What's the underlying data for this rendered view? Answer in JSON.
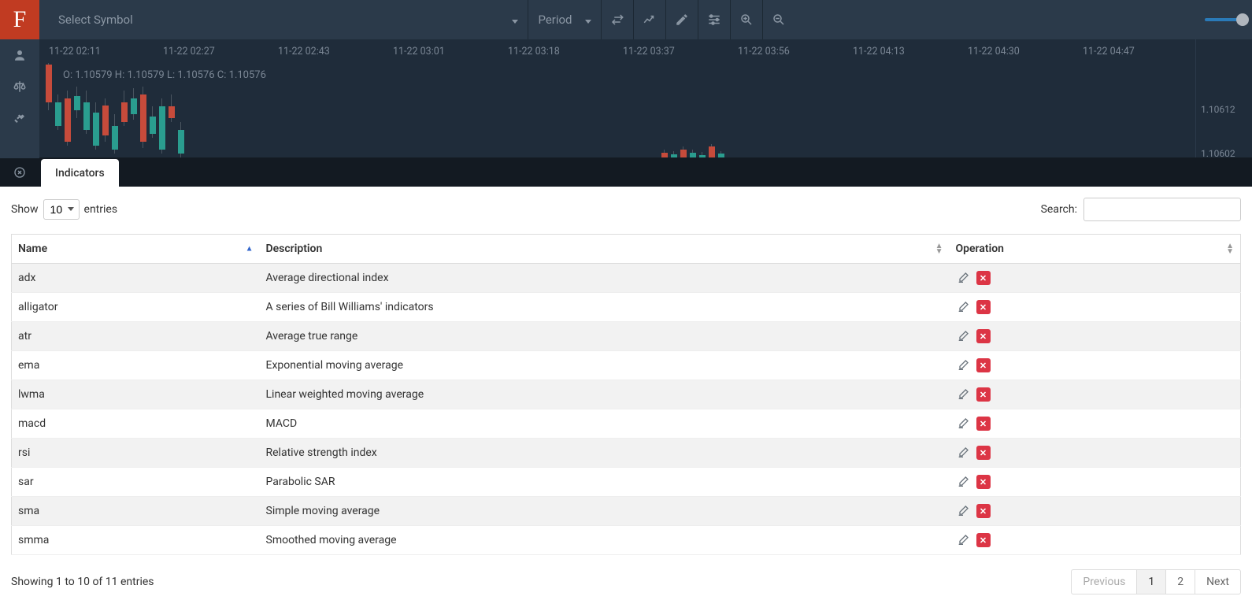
{
  "logo_letter": "F",
  "toolbar": {
    "symbol_placeholder": "Select Symbol",
    "period_label": "Period"
  },
  "chart": {
    "time_ticks": [
      "11-22 02:11",
      "11-22 02:27",
      "11-22 02:43",
      "11-22 03:01",
      "11-22 03:18",
      "11-22 03:37",
      "11-22 03:56",
      "11-22 04:13",
      "11-22 04:30",
      "11-22 04:47"
    ],
    "ohlc_text": "O: 1.10579 H: 1.10579 L: 1.10576 C: 1.10576",
    "price_ticks": [
      "1.10612",
      "1.10602"
    ]
  },
  "tab_label": "Indicators",
  "dt": {
    "show_prefix": "Show",
    "show_suffix": "entries",
    "length_options": [
      "10"
    ],
    "length_value": "10",
    "search_label": "Search:",
    "search_value": "",
    "columns": [
      "Name",
      "Description",
      "Operation"
    ],
    "rows": [
      {
        "name": "adx",
        "desc": "Average directional index"
      },
      {
        "name": "alligator",
        "desc": "A series of Bill Williams' indicators"
      },
      {
        "name": "atr",
        "desc": "Average true range"
      },
      {
        "name": "ema",
        "desc": "Exponential moving average"
      },
      {
        "name": "lwma",
        "desc": "Linear weighted moving average"
      },
      {
        "name": "macd",
        "desc": "MACD"
      },
      {
        "name": "rsi",
        "desc": "Relative strength index"
      },
      {
        "name": "sar",
        "desc": "Parabolic SAR"
      },
      {
        "name": "sma",
        "desc": "Simple moving average"
      },
      {
        "name": "smma",
        "desc": "Smoothed moving average"
      }
    ],
    "info_text": "Showing 1 to 10 of 11 entries",
    "prev_label": "Previous",
    "next_label": "Next",
    "pages": [
      "1",
      "2"
    ],
    "active_page": "1"
  },
  "icons": {
    "user": "user-icon",
    "balance": "balance-icon",
    "handshake": "handshake-icon",
    "close": "close-icon",
    "swap": "swap-icon",
    "chart": "chart-icon",
    "pencil": "pencil-icon",
    "sliders": "sliders-icon",
    "zoom_in": "zoom-in-icon",
    "zoom_out": "zoom-out-icon",
    "edit": "edit-icon",
    "delete": "delete-icon"
  }
}
